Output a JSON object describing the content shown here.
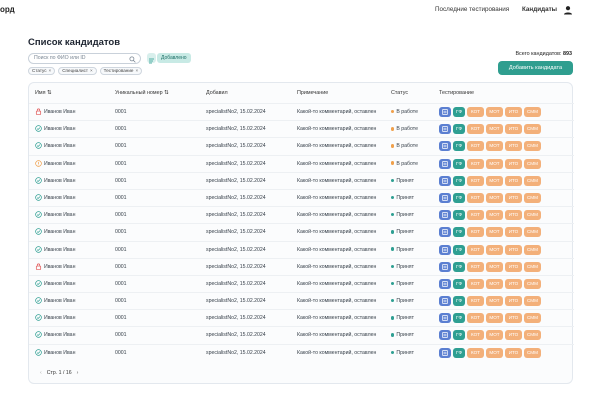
{
  "brand": "орд",
  "nav": {
    "recent": "Последние тестирования",
    "candidates": "Кандидаты"
  },
  "page_title": "Список кандидатов",
  "search": {
    "placeholder": "Поиск по ФИО или ID"
  },
  "added_chip": "Добавлено",
  "filters": [
    "Статус",
    "Специалист",
    "Тестирование"
  ],
  "total": {
    "label": "Всего кандидатов:",
    "value": "893"
  },
  "add_button": "Добавить кандидата",
  "columns": {
    "name": "Имя",
    "id": "Уникальный номер",
    "added": "Добавил",
    "note": "Примечание",
    "status": "Статус",
    "tests": "Тестирование"
  },
  "test_labels": {
    "ks": "КОТ",
    "mot": "МОТ",
    "ito": "ИТО",
    "smm": "СММ",
    "gf": "ГФ"
  },
  "colors": {
    "accent": "#2f9e8f",
    "status_ok": "#2e9f92",
    "status_wip": "#f0a04b",
    "blue_button": "#5b7fd1",
    "orange_button": "#f3b07a"
  },
  "rows": [
    {
      "name": "Иванов Иван",
      "icon": "lock-icon",
      "id": "0001",
      "added": "specialistNo2, 15.02.2024",
      "note": "Какой-то комментарий, оставлен",
      "status": "В работе",
      "state": "wip"
    },
    {
      "name": "Иванов Иван",
      "icon": "check-circle-icon",
      "id": "0001",
      "added": "specialistNo2, 15.02.2024",
      "note": "Какой-то комментарий, оставлен",
      "status": "В работе",
      "state": "wip"
    },
    {
      "name": "Иванов Иван",
      "icon": "check-circle-icon",
      "id": "0001",
      "added": "specialistNo2, 15.02.2024",
      "note": "Какой-то комментарий, оставлен",
      "status": "В работе",
      "state": "wip"
    },
    {
      "name": "Иванов Иван",
      "icon": "warning-circle-icon",
      "id": "0001",
      "added": "specialistNo2, 15.02.2024",
      "note": "Какой-то комментарий, оставлен",
      "status": "В работе",
      "state": "wip"
    },
    {
      "name": "Иванов Иван",
      "icon": "check-circle-icon",
      "id": "0001",
      "added": "specialistNo2, 15.02.2024",
      "note": "Какой-то комментарий, оставлен",
      "status": "Принят",
      "state": "ok"
    },
    {
      "name": "Иванов Иван",
      "icon": "check-circle-icon",
      "id": "0001",
      "added": "specialistNo2, 15.02.2024",
      "note": "Какой-то комментарий, оставлен",
      "status": "Принят",
      "state": "ok"
    },
    {
      "name": "Иванов Иван",
      "icon": "check-circle-icon",
      "id": "0001",
      "added": "specialistNo2, 15.02.2024",
      "note": "Какой-то комментарий, оставлен",
      "status": "Принят",
      "state": "ok"
    },
    {
      "name": "Иванов Иван",
      "icon": "check-circle-icon",
      "id": "0001",
      "added": "specialistNo2, 15.02.2024",
      "note": "Какой-то комментарий, оставлен",
      "status": "Принят",
      "state": "ok"
    },
    {
      "name": "Иванов Иван",
      "icon": "check-circle-icon",
      "id": "0001",
      "added": "specialistNo2, 15.02.2024",
      "note": "Какой-то комментарий, оставлен",
      "status": "Принят",
      "state": "ok"
    },
    {
      "name": "Иванов Иван",
      "icon": "lock-icon",
      "id": "0001",
      "added": "specialistNo2, 15.02.2024",
      "note": "Какой-то комментарий, оставлен",
      "status": "Принят",
      "state": "ok"
    },
    {
      "name": "Иванов Иван",
      "icon": "check-circle-icon",
      "id": "0001",
      "added": "specialistNo2, 15.02.2024",
      "note": "Какой-то комментарий, оставлен",
      "status": "Принят",
      "state": "ok"
    },
    {
      "name": "Иванов Иван",
      "icon": "check-circle-icon",
      "id": "0001",
      "added": "specialistNo2, 15.02.2024",
      "note": "Какой-то комментарий, оставлен",
      "status": "Принят",
      "state": "ok"
    },
    {
      "name": "Иванов Иван",
      "icon": "check-circle-icon",
      "id": "0001",
      "added": "specialistNo2, 15.02.2024",
      "note": "Какой-то комментарий, оставлен",
      "status": "Принят",
      "state": "ok"
    },
    {
      "name": "Иванов Иван",
      "icon": "check-circle-icon",
      "id": "0001",
      "added": "specialistNo2, 15.02.2024",
      "note": "Какой-то комментарий, оставлен",
      "status": "Принят",
      "state": "ok"
    },
    {
      "name": "Иванов Иван",
      "icon": "check-circle-icon",
      "id": "0001",
      "added": "specialistNo2, 15.02.2024",
      "note": "Какой-то комментарий, оставлен",
      "status": "Принят",
      "state": "ok"
    }
  ],
  "pagination": {
    "label": "Стр. 1 / 16"
  }
}
